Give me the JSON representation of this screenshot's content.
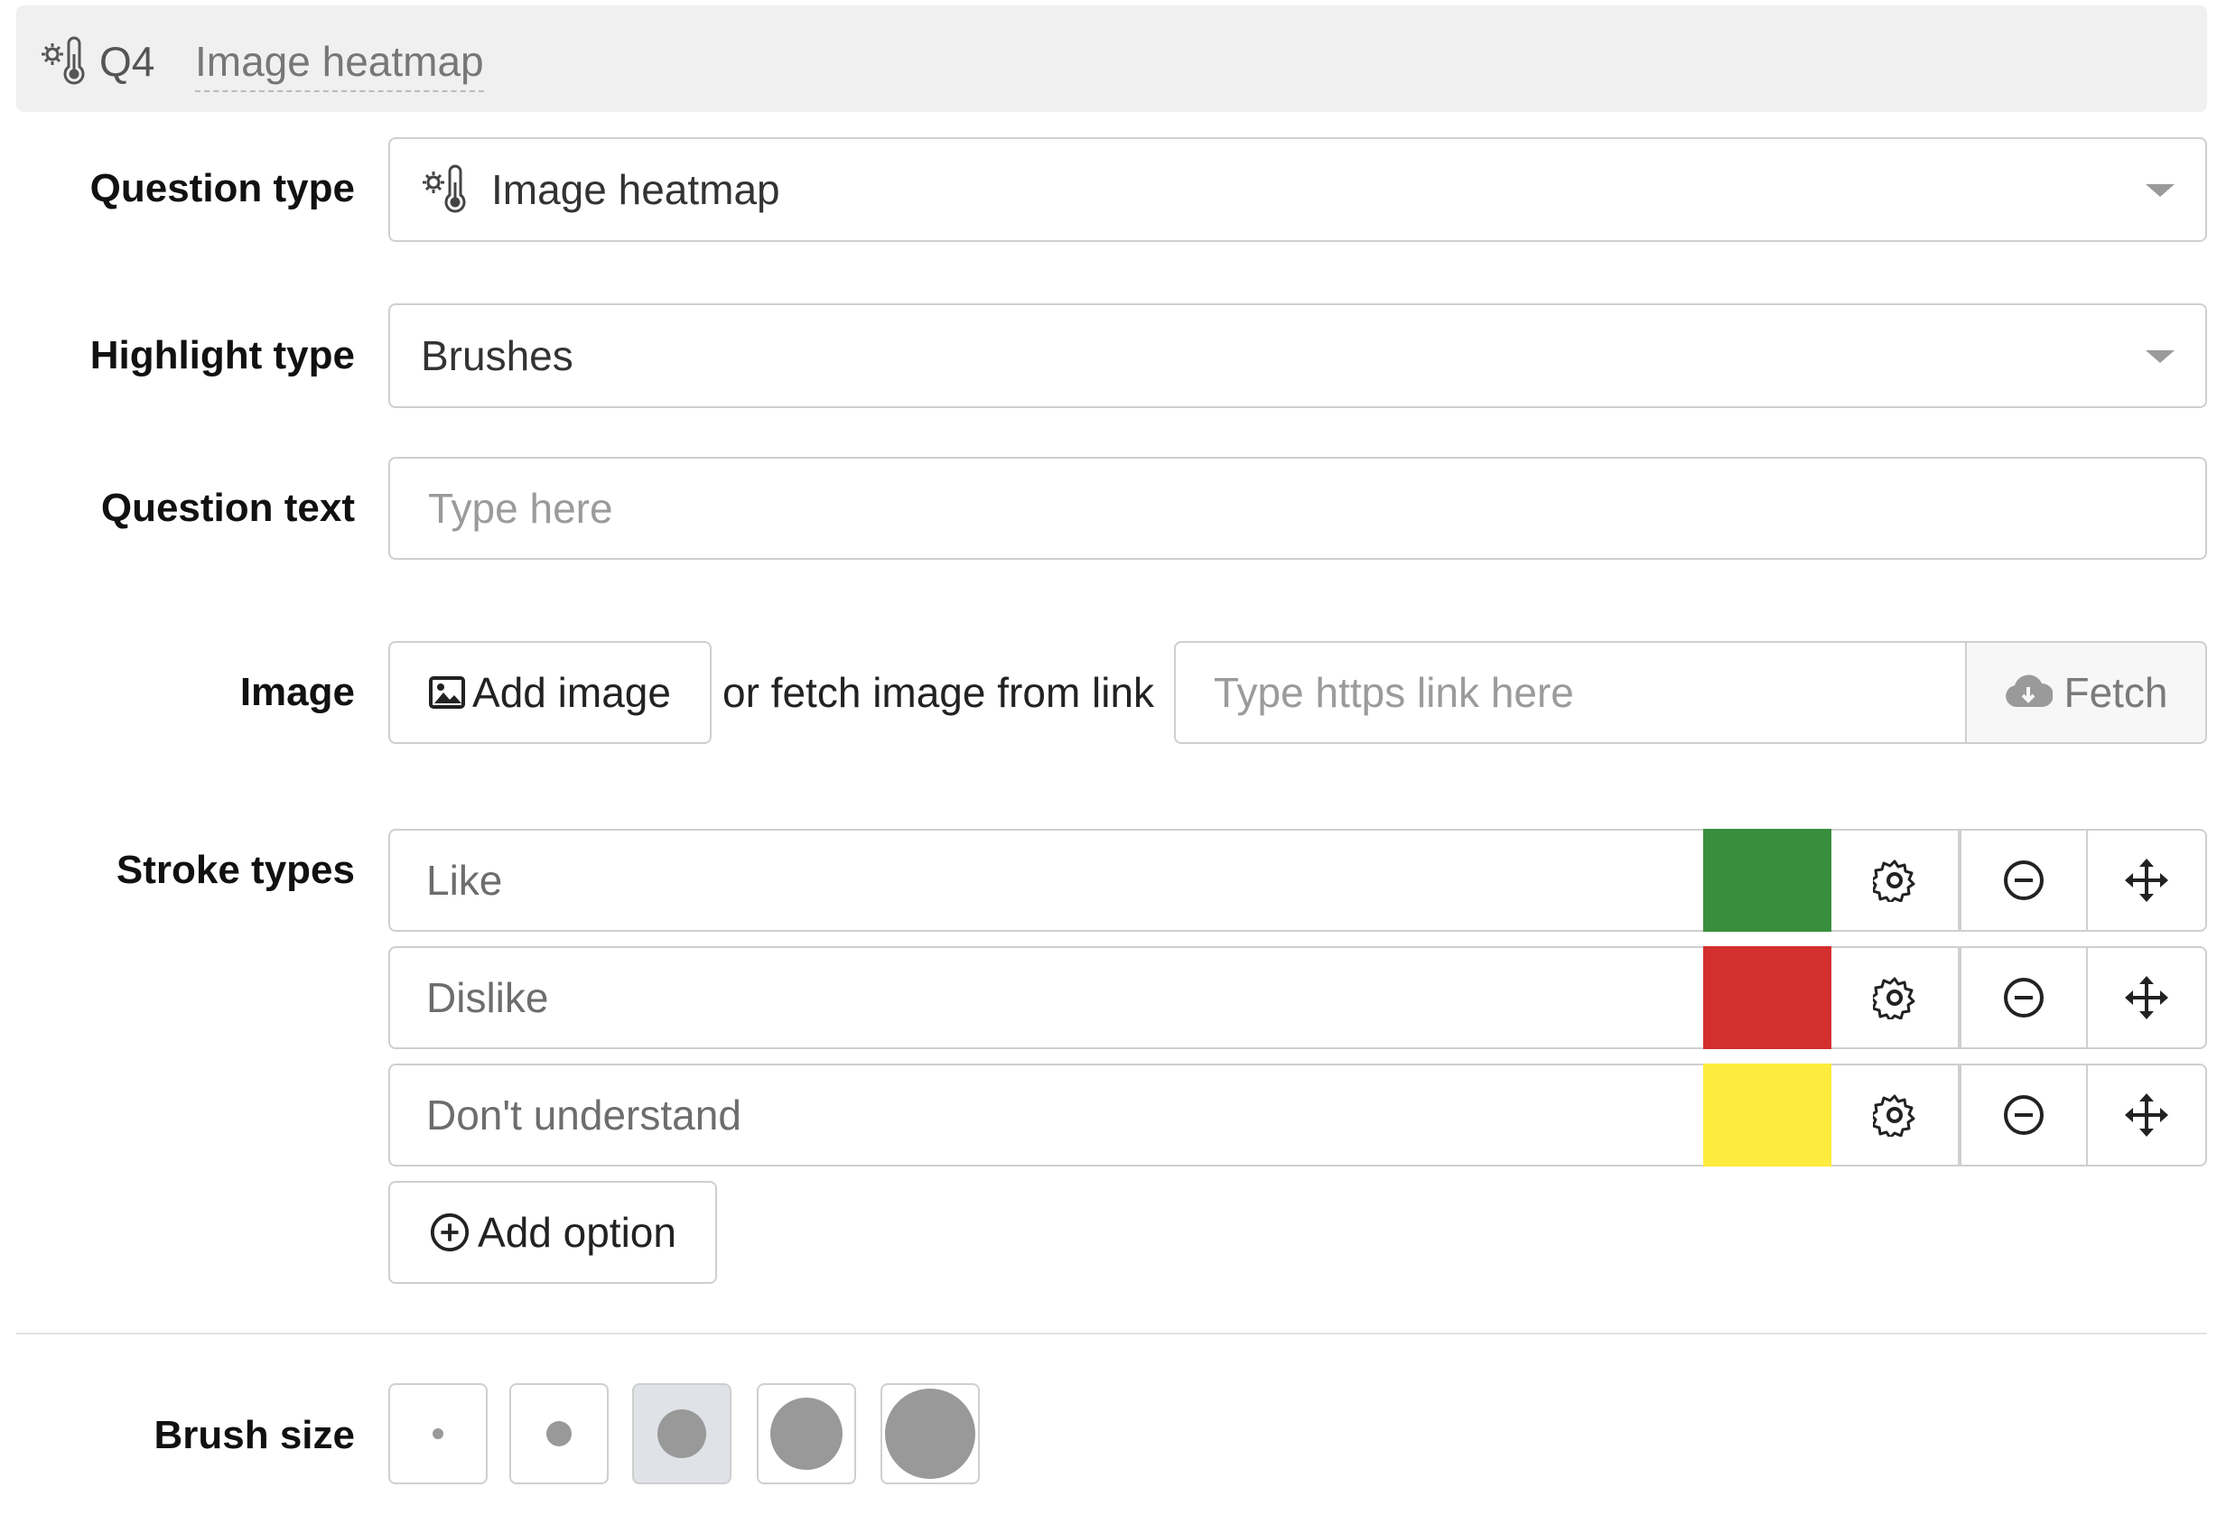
{
  "header": {
    "number": "Q4",
    "title": "Image heatmap",
    "icon": "heatmap-icon"
  },
  "question_type": {
    "label": "Question type",
    "value": "Image heatmap",
    "icon": "heatmap-icon"
  },
  "highlight_type": {
    "label": "Highlight type",
    "value": "Brushes"
  },
  "question_text": {
    "label": "Question text",
    "placeholder": "Type here"
  },
  "image": {
    "label": "Image",
    "add_button": "Add image",
    "or_text": "or fetch image from link",
    "link_placeholder": "Type https link here",
    "fetch_button": "Fetch"
  },
  "stroke_types": {
    "label": "Stroke types",
    "items": [
      {
        "value": "Like",
        "color": "#388e3c"
      },
      {
        "value": "Dislike",
        "color": "#d32f2f"
      },
      {
        "value": "Don't understand",
        "color": "#fdeb3d"
      }
    ],
    "add_option": "Add option"
  },
  "brush_size": {
    "label": "Brush size",
    "options": [
      "xs",
      "s",
      "m",
      "l",
      "xl"
    ],
    "selected_index": 2
  },
  "colors": {
    "header_bg": "#f0f0f0",
    "border": "#cfcfcf",
    "placeholder": "#9b9b9b",
    "brush_dot": "#999999",
    "selected_bg": "#dfe3e8"
  }
}
